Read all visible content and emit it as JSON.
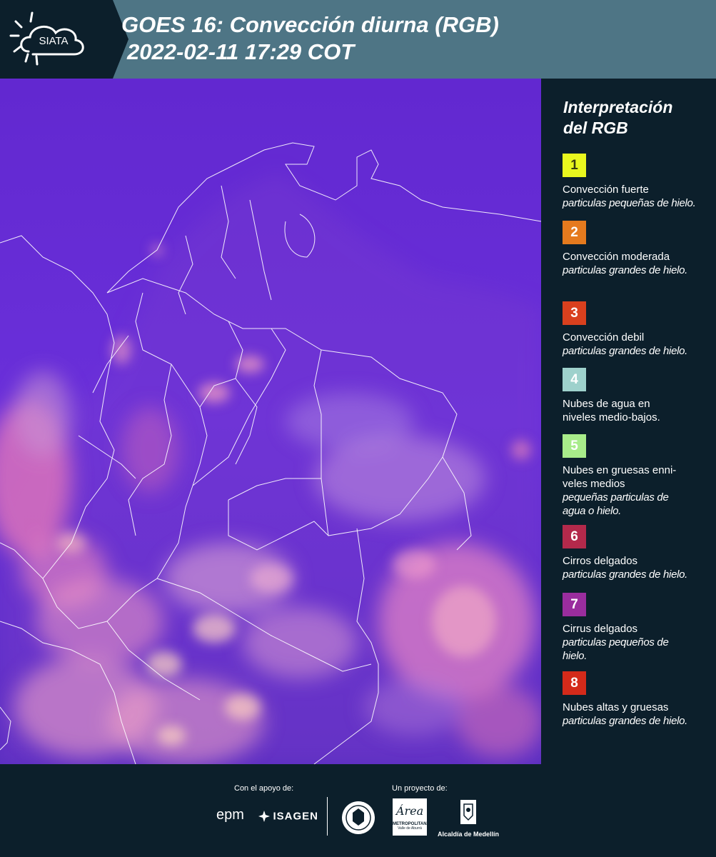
{
  "header": {
    "logo_text": "SIATA",
    "title_line1": "GOES 16: Convección diurna (RGB)",
    "title_line2": "2022-02-11 17:29 COT"
  },
  "legend": {
    "title_line1": "Interpretación",
    "title_line2": "del RGB",
    "items": [
      {
        "num": "1",
        "color": "#e9f71e",
        "text_color": "#3a3a10",
        "main": "Convección fuerte",
        "sub": "particulas pequeñas de hielo."
      },
      {
        "num": "2",
        "color": "#e57a1e",
        "text_color": "#ffffff",
        "main": "Convección moderada",
        "sub": "particulas grandes de hielo."
      },
      {
        "num": "3",
        "color": "#d9401e",
        "text_color": "#ffffff",
        "main": "Convección debil",
        "sub": "particulas grandes de hielo."
      },
      {
        "num": "4",
        "color": "#9ed1cc",
        "text_color": "#ffffff",
        "main": "Nubes de agua en niveles medio-bajos.",
        "sub": ""
      },
      {
        "num": "5",
        "color": "#a8ec8a",
        "text_color": "#ffffff",
        "main": "Nubes en gruesas enni-veles medios",
        "sub": "pequeñas particulas de agua o hielo."
      },
      {
        "num": "6",
        "color": "#b3294b",
        "text_color": "#ffffff",
        "main": "Cirros delgados",
        "sub": "particulas grandes de hielo."
      },
      {
        "num": "7",
        "color": "#9a2d9e",
        "text_color": "#ffffff",
        "main": "Cirrus delgados",
        "sub": "particulas pequeños de hielo."
      },
      {
        "num": "8",
        "color": "#d42a1a",
        "text_color": "#ffffff",
        "main": "Nubes altas y gruesas",
        "sub": "particulas grandes de hielo."
      }
    ]
  },
  "footer": {
    "support_label": "Con el apoyo de:",
    "project_label": "Un proyecto de:",
    "sponsor1": "epm",
    "sponsor2": "ISAGEN",
    "partner1": "METROPOLITANA",
    "partner1_script": "Área",
    "partner1_sub": "Valle de Aburrá",
    "partner2": "Alcaldía de Medellín"
  }
}
